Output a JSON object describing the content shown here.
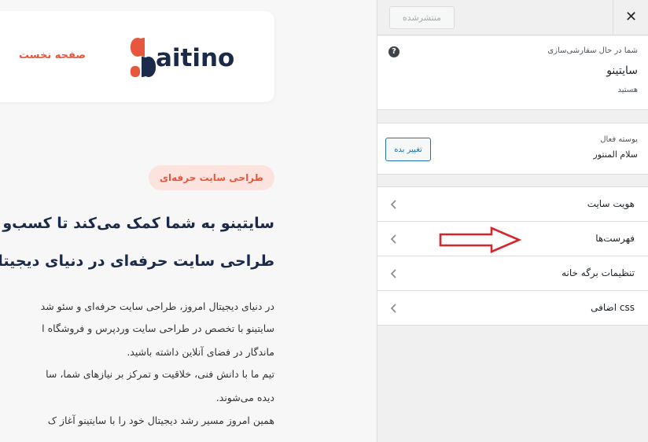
{
  "preview": {
    "home_link": "صفحه نخست",
    "logo_text": "aitino",
    "badge": "طراحی سایت حرفه‌ای",
    "hero_line_1": "سایتینو به شما کمک می‌کند تا کسب‌و",
    "hero_line_2": "طراحی سایت حرفه‌ای در دنیای دیجیتال",
    "paragraph_lines": [
      "در دنیای دیجیتال امروز، طراحی سایت حرفه‌ای و سئو شد",
      "سایتینو با تخصص در طراحی سایت وردپرس و فروشگاه ا",
      "ماندگار در فضای آنلاین داشته باشید.",
      "تیم ما با دانش فنی، خلاقیت و تمرکز بر نیازهای شما، سا",
      "دیده می‌شوند.",
      "همین امروز مسیر رشد دیجیتال خود را با سایتینو آغاز ک"
    ],
    "colors": {
      "accent": "#e8573d",
      "brand_dark": "#1b2a4a",
      "badge_bg": "#fde3de"
    }
  },
  "panel": {
    "publish_label": "منتشرشده",
    "close_glyph": "✕",
    "info": {
      "label": "شما در حال سفارشی‌سازی",
      "title": "سایتینو",
      "subtitle": "هستید",
      "help_glyph": "?"
    },
    "theme": {
      "label": "پوسته فعال",
      "name": "سلام المنتور",
      "change_label": "تغییر بده"
    },
    "menu_items": [
      {
        "label": "هویت سایت"
      },
      {
        "label": "فهرست‌ها"
      },
      {
        "label": "تنظیمات برگه خانه"
      },
      {
        "label": "css اضافی"
      }
    ],
    "colors": {
      "button_blue": "#2271b1",
      "annotation_arrow": "#d6262b"
    }
  }
}
